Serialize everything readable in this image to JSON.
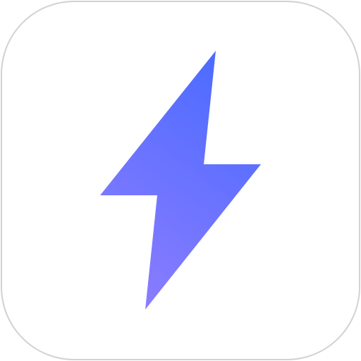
{
  "app_icon": {
    "icon": "lightning-bolt-icon",
    "gradient_start": "#4a6bff",
    "gradient_end": "#8a7cff",
    "tile_border_color": "#d2d2d2",
    "tile_background": "#ffffff"
  }
}
